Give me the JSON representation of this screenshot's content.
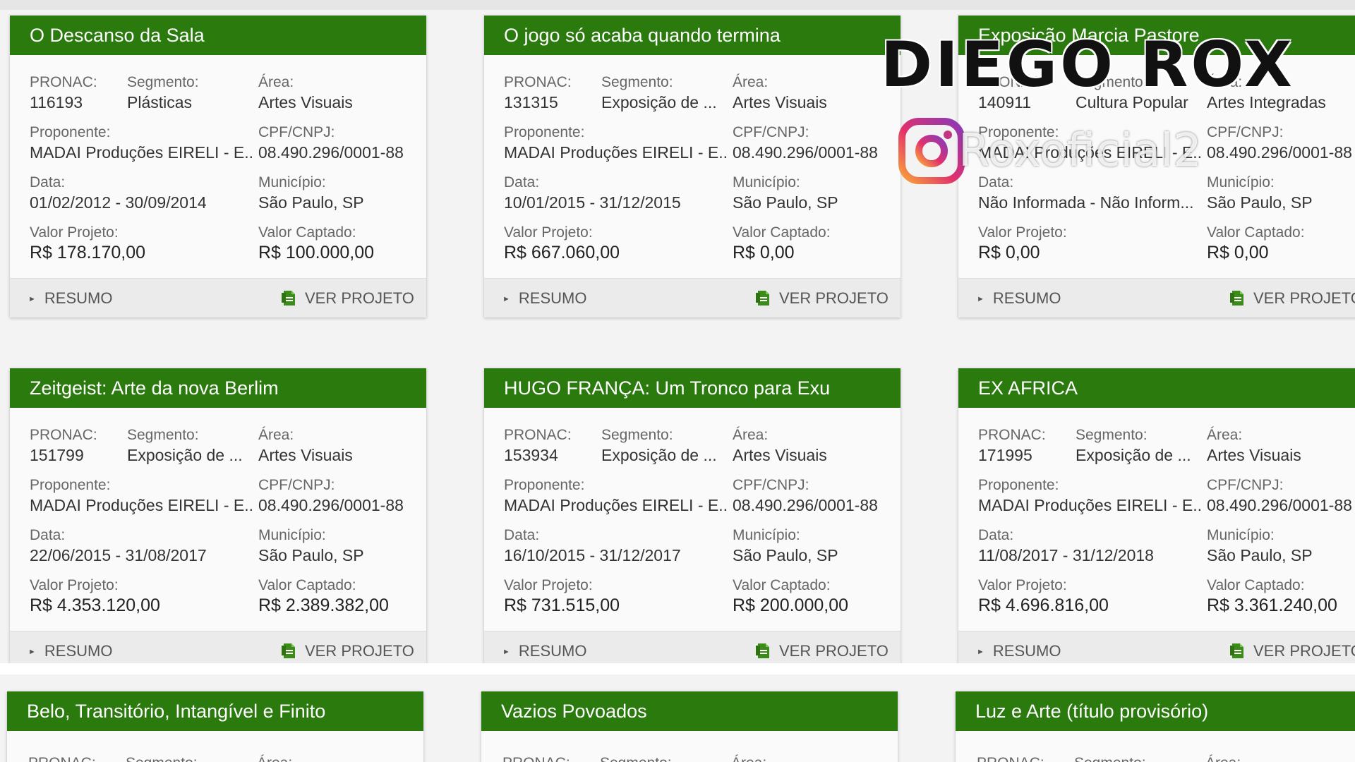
{
  "labels": {
    "pronac": "PRONAC:",
    "segmento": "Segmento:",
    "area": "Área:",
    "proponente": "Proponente:",
    "cpf": "CPF/CNPJ:",
    "data": "Data:",
    "municipio": "Município:",
    "valor_projeto": "Valor Projeto:",
    "valor_captado": "Valor Captado:",
    "resumo": "RESUMO",
    "ver_projeto": "VER PROJETO"
  },
  "cards": [
    {
      "title": "O Descanso da Sala",
      "pronac": "116193",
      "segmento": "Plásticas",
      "area": "Artes Visuais",
      "proponente": "MADAI Produções EIRELI - E...",
      "cpf": "08.490.296/0001-88",
      "data": "01/02/2012 - 30/09/2014",
      "municipio": "São Paulo, SP",
      "valor_projeto": "R$ 178.170,00",
      "valor_captado": "R$ 100.000,00"
    },
    {
      "title": "O jogo só acaba quando termina",
      "pronac": "131315",
      "segmento": "Exposição de ...",
      "area": "Artes Visuais",
      "proponente": "MADAI Produções EIRELI - E...",
      "cpf": "08.490.296/0001-88",
      "data": "10/01/2015 - 31/12/2015",
      "municipio": "São Paulo, SP",
      "valor_projeto": "R$ 667.060,00",
      "valor_captado": "R$ 0,00"
    },
    {
      "title": "Exposição Marcia Pastore",
      "pronac": "140911",
      "segmento": "Cultura Popular",
      "area": "Artes Integradas",
      "proponente": "MADAI Produções EIRELI - E...",
      "cpf": "08.490.296/0001-88",
      "data": "Não Informada - Não Inform...",
      "municipio": "São Paulo, SP",
      "valor_projeto": "R$ 0,00",
      "valor_captado": "R$ 0,00"
    },
    {
      "title": "Zeitgeist: Arte da nova Berlim",
      "pronac": "151799",
      "segmento": "Exposição de ...",
      "area": "Artes Visuais",
      "proponente": "MADAI Produções EIRELI - E...",
      "cpf": "08.490.296/0001-88",
      "data": "22/06/2015 - 31/08/2017",
      "municipio": "São Paulo, SP",
      "valor_projeto": "R$ 4.353.120,00",
      "valor_captado": "R$ 2.389.382,00"
    },
    {
      "title": "HUGO FRANÇA: Um Tronco para Exu",
      "pronac": "153934",
      "segmento": "Exposição de ...",
      "area": "Artes Visuais",
      "proponente": "MADAI Produções EIRELI - E...",
      "cpf": "08.490.296/0001-88",
      "data": "16/10/2015 - 31/12/2017",
      "municipio": "São Paulo, SP",
      "valor_projeto": "R$ 731.515,00",
      "valor_captado": "R$ 200.000,00"
    },
    {
      "title": "EX AFRICA",
      "pronac": "171995",
      "segmento": "Exposição de ...",
      "area": "Artes Visuais",
      "proponente": "MADAI Produções EIRELI - E...",
      "cpf": "08.490.296/0001-88",
      "data": "11/08/2017 - 31/12/2018",
      "municipio": "São Paulo, SP",
      "valor_projeto": "R$ 4.696.816,00",
      "valor_captado": "R$ 3.361.240,00"
    }
  ],
  "partial_cards": [
    {
      "title": "Belo, Transitório, Intangível e Finito"
    },
    {
      "title": "Vazios Povoados"
    },
    {
      "title": "Luz e Arte (título provisório)"
    }
  ],
  "watermark": {
    "title": "DIEGO ROX",
    "handle": "Roxoficial2",
    "icon": "instagram-icon"
  },
  "colors": {
    "header_green": "#2a7a0e",
    "icon_green": "#3c8c1a"
  }
}
